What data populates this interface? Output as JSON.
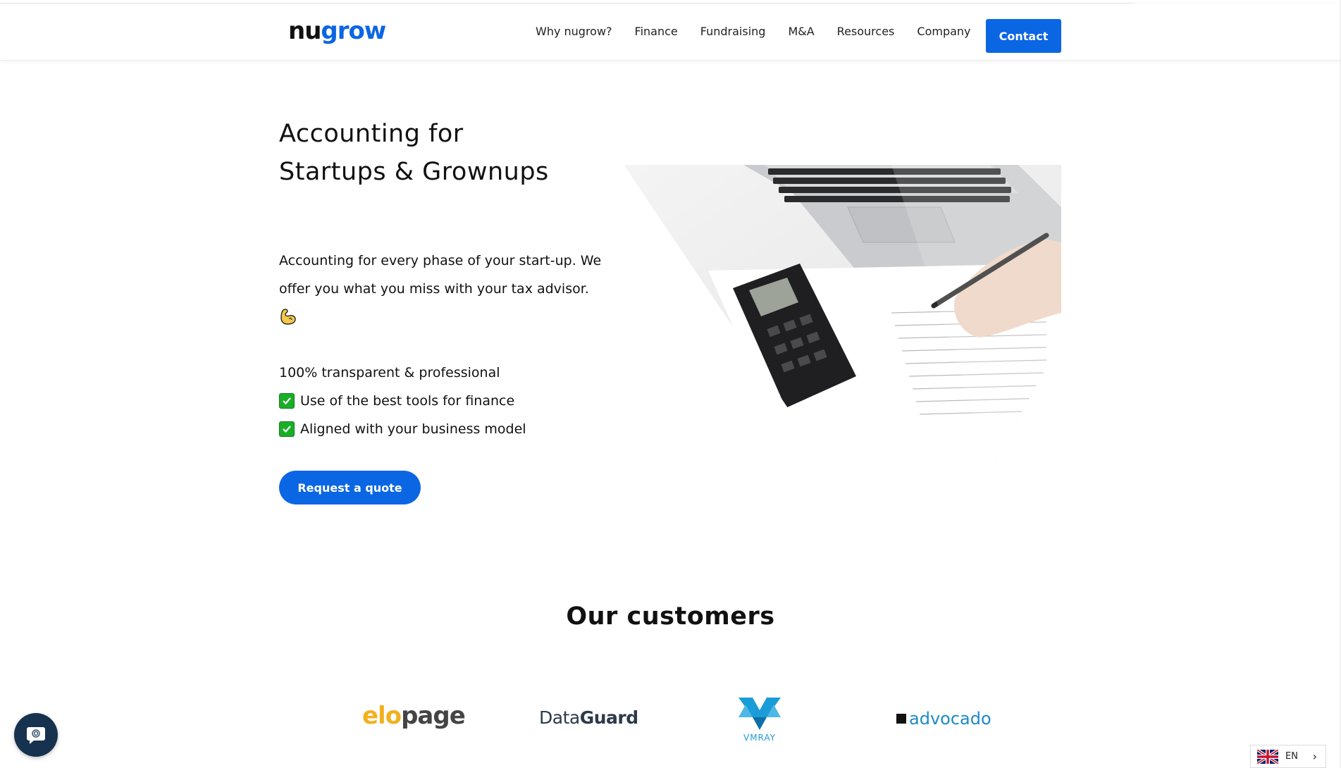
{
  "brand": {
    "logo_part1": "nu",
    "logo_part2": "grow"
  },
  "nav": {
    "items": [
      "Why nugrow?",
      "Finance",
      "Fundraising",
      "M&A",
      "Resources",
      "Company"
    ],
    "contact_label": "Contact"
  },
  "hero": {
    "title": "Accounting for Startups & Grownups",
    "subtitle": "Accounting for every phase of your start-up. We offer you what you miss with your tax advisor.",
    "feature_plain": "100% transparent & professional",
    "features": [
      "Use of the best tools for finance",
      "Aligned with your business model"
    ],
    "cta_label": "Request a quote"
  },
  "customers": {
    "title": "Our customers",
    "logos": {
      "elopage_1": "elo",
      "elopage_2": "page",
      "dataguard_1": "Data",
      "dataguard_2": "Guard",
      "vmray": "VMRAY",
      "advocado": "advocado"
    }
  },
  "language": {
    "code": "EN"
  },
  "colors": {
    "accent": "#0b66e4",
    "check": "#1aae27",
    "chat": "#16324f"
  }
}
